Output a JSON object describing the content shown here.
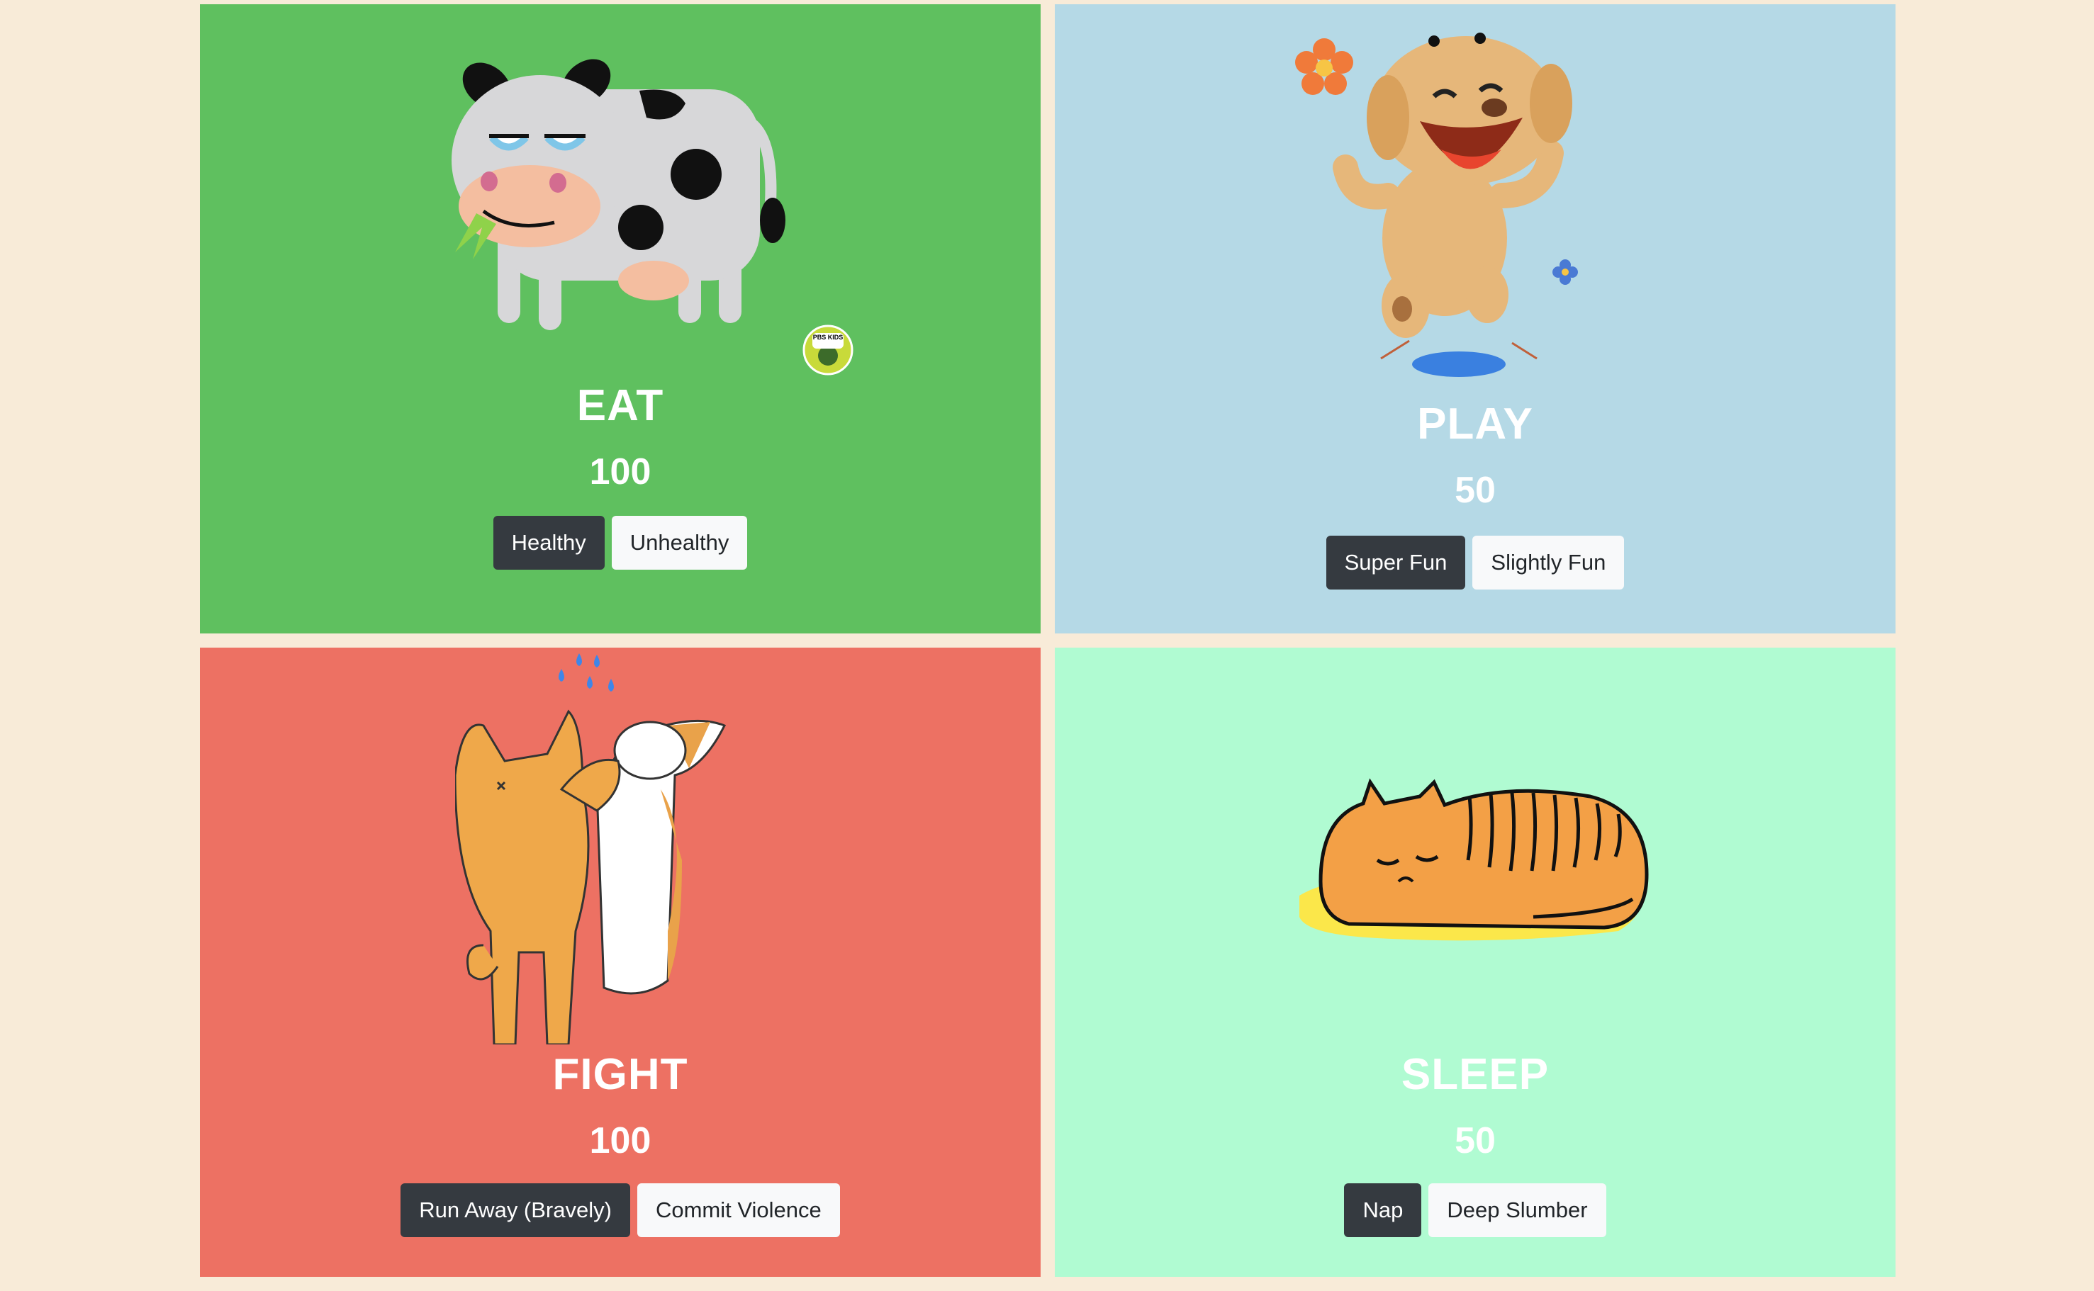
{
  "cards": [
    {
      "title": "EAT",
      "score": "100",
      "buttons": [
        "Healthy",
        "Unhealthy"
      ]
    },
    {
      "title": "PLAY",
      "score": "50",
      "buttons": [
        "Super Fun",
        "Slightly Fun"
      ]
    },
    {
      "title": "FIGHT",
      "score": "100",
      "buttons": [
        "Run Away (Bravely)",
        "Commit Violence"
      ]
    },
    {
      "title": "SLEEP",
      "score": "50",
      "buttons": [
        "Nap",
        "Deep Slumber"
      ]
    }
  ],
  "logo": {
    "text": "PBS KIDS"
  },
  "colors": {
    "page_bg": "#f8ebd8",
    "eat_bg": "#5fc05f",
    "play_bg": "#b5d9e6",
    "fight_bg": "#ed7163",
    "sleep_bg": "#b0fbd2",
    "button_dark": "#353a40",
    "button_light": "#f8f9fa"
  },
  "icons": [
    "cow-illustration",
    "happy-dog-illustration",
    "fighting-dogs-illustration",
    "sleeping-cat-illustration",
    "pbs-kids-logo-icon"
  ]
}
